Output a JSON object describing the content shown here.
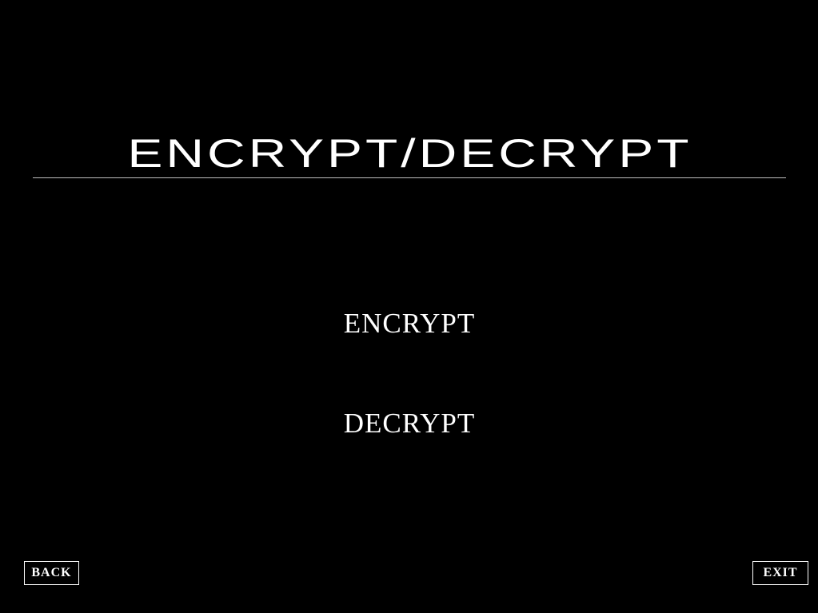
{
  "screen": {
    "title": "ENCRYPT/DECRYPT",
    "background_color": "#000000",
    "text_color": "#ffffff"
  },
  "menu": {
    "encrypt_label": "ENCRYPT",
    "decrypt_label": "DECRYPT"
  },
  "footer": {
    "back_label": "BACK",
    "exit_label": "EXIT"
  }
}
